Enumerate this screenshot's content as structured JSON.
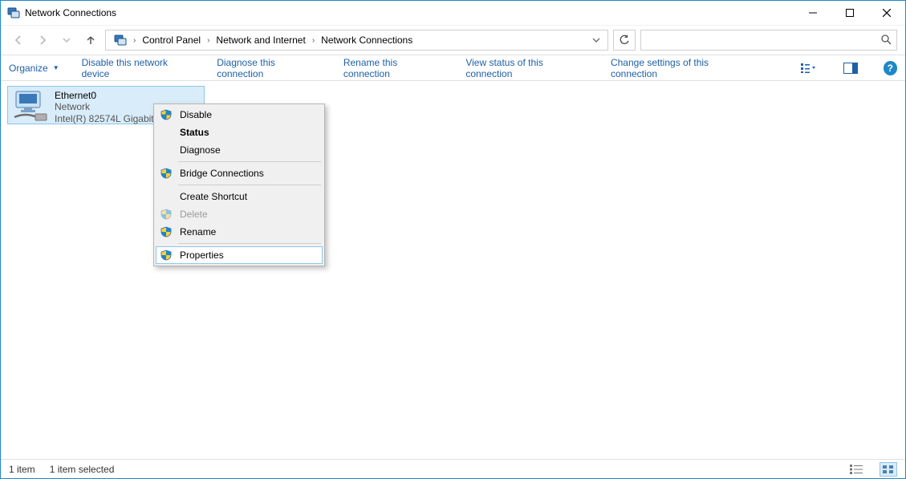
{
  "window": {
    "title": "Network Connections"
  },
  "breadcrumbs": {
    "root": "Control Panel",
    "mid": "Network and Internet",
    "leaf": "Network Connections"
  },
  "search": {
    "placeholder": ""
  },
  "commands": {
    "organize": "Organize",
    "disable_device": "Disable this network device",
    "diagnose": "Diagnose this connection",
    "rename": "Rename this connection",
    "view_status": "View status of this connection",
    "change_settings": "Change settings of this connection"
  },
  "adapter": {
    "name": "Ethernet0",
    "status": "Network",
    "device": "Intel(R) 82574L Gigabit N"
  },
  "context_menu": {
    "disable": "Disable",
    "status": "Status",
    "diagnose": "Diagnose",
    "bridge": "Bridge Connections",
    "shortcut": "Create Shortcut",
    "delete": "Delete",
    "rename": "Rename",
    "properties": "Properties"
  },
  "statusbar": {
    "count": "1 item",
    "selected": "1 item selected"
  }
}
